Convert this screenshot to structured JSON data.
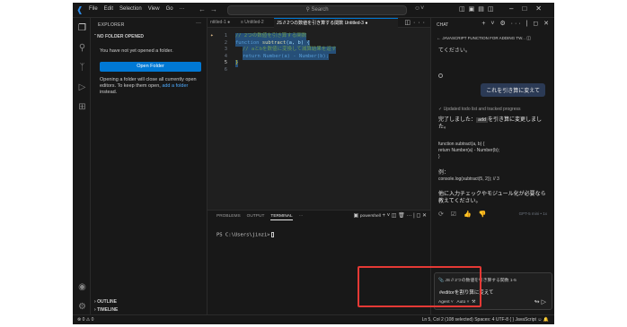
{
  "menu": [
    "File",
    "Edit",
    "Selection",
    "View",
    "Go",
    "···"
  ],
  "search_label": "Search",
  "sidebar": {
    "title": "EXPLORER",
    "section": "NO FOLDER OPENED",
    "no_folder_text": "You have not yet opened a folder.",
    "open_button": "Open Folder",
    "para_text": "Opening a folder will close all currently open editors. To keep them open,",
    "para_link": "add a folder",
    "para_tail": "instead.",
    "outline": "OUTLINE",
    "timeline": "TIMELINE"
  },
  "tabs": [
    {
      "label": "ntitled-1 ●"
    },
    {
      "label": "≡ Untitled-2"
    },
    {
      "label": "JS // 2つの数値を引き算する関数 Untitled-3 ●"
    }
  ],
  "code": {
    "line1": "// 2つの数値を引き算する関数",
    "line2_kw": "function",
    "line2_fn": "subtract",
    "line2_rest": "(a, b) {",
    "line3": "// aとbを数値に変換して減算結果を返す",
    "line4": "return Number(a) - Number(b);",
    "line5": "}"
  },
  "panel": {
    "tabs": [
      "PROBLEMS",
      "OUTPUT",
      "TERMINAL",
      "···"
    ],
    "shell": "powershell",
    "prompt": "PS C:\\Users\\jinzi>"
  },
  "chat": {
    "title": "CHAT",
    "back_title": "JAVASCRIPT FUNCTION FOR ADDING TW...",
    "t1": "てください。",
    "user_msg": "これを引き算に変えて",
    "status": "Updated todo list and tracked progress",
    "done_pre": "完了しました：",
    "done_code": "add",
    "done_post": "を引き算に変更しました。",
    "code1": "function subtract(a, b) {",
    "code2": "return Number(a) - Number(b);",
    "code3": "}",
    "ex_label": "例：",
    "ex_code": "console.log(subtract(5, 2)); // 3",
    "t2": "他に入力チェックやモジュール化が必要なら教えてください。",
    "model": "GPT-5 mini • 1x",
    "context_chip": "JS // 2つの数値を引き算する関数 1-5",
    "input_text": "#editorを割り算に変えて",
    "mode": "Agent ˅",
    "model_pick": "Auto ˅"
  },
  "status": {
    "left": "⊗ 0 ⚠ 0",
    "right": "Ln 5, Col 2 (108 selected)   Spaces: 4   UTF-8   { }  JavaScript"
  }
}
